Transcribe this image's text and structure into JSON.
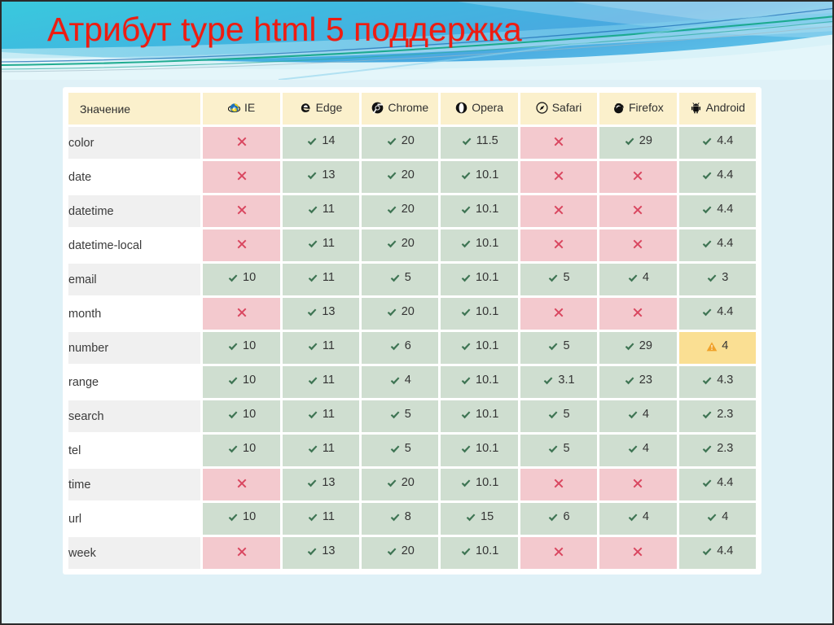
{
  "slide": {
    "title": "Атрибут type html 5 поддержка",
    "background_color": "#dff1f7",
    "title_color": "#ee1c11",
    "banner_colors": {
      "cyan": "#2ec4d8",
      "blue": "#2a9fd8",
      "teal": "#16a88a",
      "pale": "#d9f2f8"
    }
  },
  "table": {
    "colors": {
      "header_bg": "#fbf0cc",
      "yes_bg": "#cfded0",
      "no_bg": "#f3c9ce",
      "warn_bg": "#fadf93",
      "row_odd_bg": "#f0f0f0",
      "row_even_bg": "#ffffff",
      "check": "#3f7554",
      "cross": "#d9465f",
      "warning": "#f0a128"
    },
    "columns": [
      {
        "label": "Значение",
        "icon": ""
      },
      {
        "label": "IE",
        "icon": "internet-explorer-icon"
      },
      {
        "label": "Edge",
        "icon": "edge-icon"
      },
      {
        "label": "Chrome",
        "icon": "chrome-icon"
      },
      {
        "label": "Opera",
        "icon": "opera-icon"
      },
      {
        "label": "Safari",
        "icon": "safari-icon"
      },
      {
        "label": "Firefox",
        "icon": "firefox-icon"
      },
      {
        "label": "Android",
        "icon": "android-icon"
      }
    ],
    "rows": [
      {
        "value": "color",
        "cells": [
          {
            "state": "no",
            "text": ""
          },
          {
            "state": "yes",
            "text": "14"
          },
          {
            "state": "yes",
            "text": "20"
          },
          {
            "state": "yes",
            "text": "11.5"
          },
          {
            "state": "no",
            "text": ""
          },
          {
            "state": "yes",
            "text": "29"
          },
          {
            "state": "yes",
            "text": "4.4"
          }
        ]
      },
      {
        "value": "date",
        "cells": [
          {
            "state": "no",
            "text": ""
          },
          {
            "state": "yes",
            "text": "13"
          },
          {
            "state": "yes",
            "text": "20"
          },
          {
            "state": "yes",
            "text": "10.1"
          },
          {
            "state": "no",
            "text": ""
          },
          {
            "state": "no",
            "text": ""
          },
          {
            "state": "yes",
            "text": "4.4"
          }
        ]
      },
      {
        "value": "datetime",
        "cells": [
          {
            "state": "no",
            "text": ""
          },
          {
            "state": "yes",
            "text": "11"
          },
          {
            "state": "yes",
            "text": "20"
          },
          {
            "state": "yes",
            "text": "10.1"
          },
          {
            "state": "no",
            "text": ""
          },
          {
            "state": "no",
            "text": ""
          },
          {
            "state": "yes",
            "text": "4.4"
          }
        ]
      },
      {
        "value": "datetime-local",
        "cells": [
          {
            "state": "no",
            "text": ""
          },
          {
            "state": "yes",
            "text": "11"
          },
          {
            "state": "yes",
            "text": "20"
          },
          {
            "state": "yes",
            "text": "10.1"
          },
          {
            "state": "no",
            "text": ""
          },
          {
            "state": "no",
            "text": ""
          },
          {
            "state": "yes",
            "text": "4.4"
          }
        ]
      },
      {
        "value": "email",
        "cells": [
          {
            "state": "yes",
            "text": "10"
          },
          {
            "state": "yes",
            "text": "11"
          },
          {
            "state": "yes",
            "text": "5"
          },
          {
            "state": "yes",
            "text": "10.1"
          },
          {
            "state": "yes",
            "text": "5"
          },
          {
            "state": "yes",
            "text": "4"
          },
          {
            "state": "yes",
            "text": "3"
          }
        ]
      },
      {
        "value": "month",
        "cells": [
          {
            "state": "no",
            "text": ""
          },
          {
            "state": "yes",
            "text": "13"
          },
          {
            "state": "yes",
            "text": "20"
          },
          {
            "state": "yes",
            "text": "10.1"
          },
          {
            "state": "no",
            "text": ""
          },
          {
            "state": "no",
            "text": ""
          },
          {
            "state": "yes",
            "text": "4.4"
          }
        ]
      },
      {
        "value": "number",
        "cells": [
          {
            "state": "yes",
            "text": "10"
          },
          {
            "state": "yes",
            "text": "11"
          },
          {
            "state": "yes",
            "text": "6"
          },
          {
            "state": "yes",
            "text": "10.1"
          },
          {
            "state": "yes",
            "text": "5"
          },
          {
            "state": "yes",
            "text": "29"
          },
          {
            "state": "warn",
            "text": "4"
          }
        ]
      },
      {
        "value": "range",
        "cells": [
          {
            "state": "yes",
            "text": "10"
          },
          {
            "state": "yes",
            "text": "11"
          },
          {
            "state": "yes",
            "text": "4"
          },
          {
            "state": "yes",
            "text": "10.1"
          },
          {
            "state": "yes",
            "text": "3.1"
          },
          {
            "state": "yes",
            "text": "23"
          },
          {
            "state": "yes",
            "text": "4.3"
          }
        ]
      },
      {
        "value": "search",
        "cells": [
          {
            "state": "yes",
            "text": "10"
          },
          {
            "state": "yes",
            "text": "11"
          },
          {
            "state": "yes",
            "text": "5"
          },
          {
            "state": "yes",
            "text": "10.1"
          },
          {
            "state": "yes",
            "text": "5"
          },
          {
            "state": "yes",
            "text": "4"
          },
          {
            "state": "yes",
            "text": "2.3"
          }
        ]
      },
      {
        "value": "tel",
        "cells": [
          {
            "state": "yes",
            "text": "10"
          },
          {
            "state": "yes",
            "text": "11"
          },
          {
            "state": "yes",
            "text": "5"
          },
          {
            "state": "yes",
            "text": "10.1"
          },
          {
            "state": "yes",
            "text": "5"
          },
          {
            "state": "yes",
            "text": "4"
          },
          {
            "state": "yes",
            "text": "2.3"
          }
        ]
      },
      {
        "value": "time",
        "cells": [
          {
            "state": "no",
            "text": ""
          },
          {
            "state": "yes",
            "text": "13"
          },
          {
            "state": "yes",
            "text": "20"
          },
          {
            "state": "yes",
            "text": "10.1"
          },
          {
            "state": "no",
            "text": ""
          },
          {
            "state": "no",
            "text": ""
          },
          {
            "state": "yes",
            "text": "4.4"
          }
        ]
      },
      {
        "value": "url",
        "cells": [
          {
            "state": "yes",
            "text": "10"
          },
          {
            "state": "yes",
            "text": "11"
          },
          {
            "state": "yes",
            "text": "8"
          },
          {
            "state": "yes",
            "text": "15"
          },
          {
            "state": "yes",
            "text": "6"
          },
          {
            "state": "yes",
            "text": "4"
          },
          {
            "state": "yes",
            "text": "4"
          }
        ]
      },
      {
        "value": "week",
        "cells": [
          {
            "state": "no",
            "text": ""
          },
          {
            "state": "yes",
            "text": "13"
          },
          {
            "state": "yes",
            "text": "20"
          },
          {
            "state": "yes",
            "text": "10.1"
          },
          {
            "state": "no",
            "text": ""
          },
          {
            "state": "no",
            "text": ""
          },
          {
            "state": "yes",
            "text": "4.4"
          }
        ]
      }
    ]
  }
}
